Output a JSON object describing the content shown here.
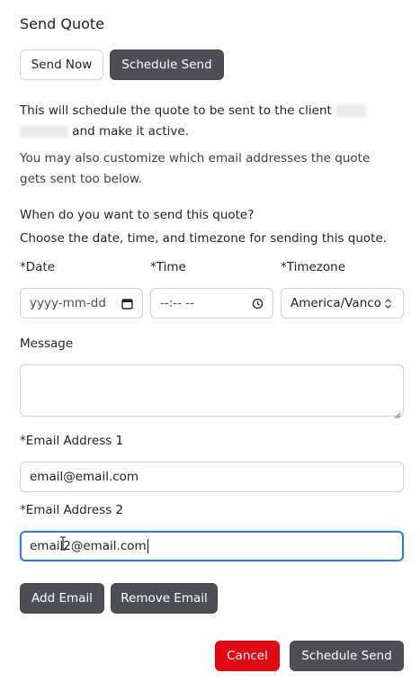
{
  "header": {
    "title": "Send Quote"
  },
  "mode_tabs": {
    "send_now": "Send Now",
    "schedule_send": "Schedule Send"
  },
  "info": {
    "line1": "This will schedule the quote to be sent to the client",
    "line2_suffix": "and make it active.",
    "customize_line1": "You may also customize which email addresses the quote",
    "customize_line2": "gets sent too below."
  },
  "schedule": {
    "question": "When do you want to send this quote?",
    "hint": "Choose the date, time, and timezone for sending this quote.",
    "date_label": "*Date",
    "time_label": "*Time",
    "timezone_label": "*Timezone",
    "date_value": "yyyy-mm-dd",
    "time_value": "--:-- --",
    "timezone_value": "America/Vancouver"
  },
  "message": {
    "label": "Message",
    "value": ""
  },
  "emails": [
    {
      "label": "*Email Address 1",
      "value": "email@email.com"
    },
    {
      "label": "*Email Address 2",
      "value": "email2@email.com"
    }
  ],
  "email_actions": {
    "add": "Add Email",
    "remove": "Remove Email"
  },
  "footer": {
    "cancel": "Cancel",
    "submit": "Schedule Send"
  },
  "colors": {
    "dark_button": "#4d4f56",
    "danger": "#e30914",
    "focus": "#2f7fdc"
  },
  "icons": {
    "date": "calendar-icon",
    "time": "clock-icon",
    "timezone": "updown-chevron-icon"
  }
}
